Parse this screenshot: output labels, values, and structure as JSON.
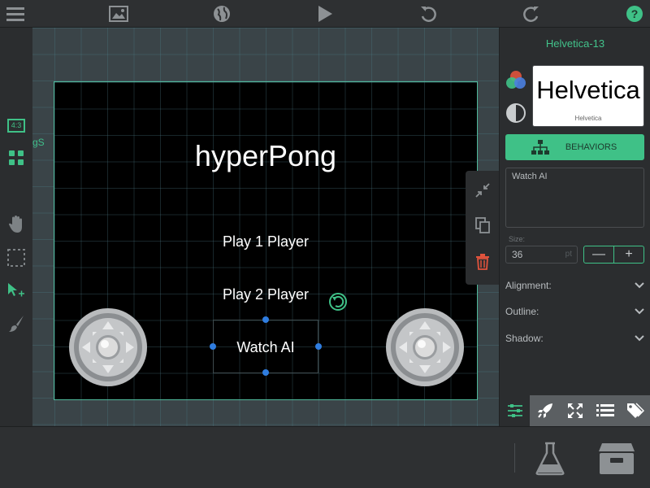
{
  "toolbar": {
    "icons": [
      "menu-icon",
      "image-icon",
      "globe-icon",
      "play-icon",
      "undo-icon",
      "redo-icon",
      "help-icon"
    ]
  },
  "leftbar": {
    "aspect_label": "4:3"
  },
  "canvas": {
    "side_label": "gS",
    "title": "hyperPong",
    "menu": {
      "play1": "Play 1 Player",
      "play2": "Play 2 Player",
      "watch_ai": "Watch AI"
    }
  },
  "panel": {
    "font_name": "Helvetica-13",
    "preview_big": "Helvetica",
    "preview_small": "Helvetica",
    "behaviors_label": "BEHAVIORS",
    "text_value": "Watch AI",
    "size_label": "Size:",
    "size_value": "36",
    "size_unit": "pt",
    "alignment_label": "Alignment:",
    "outline_label": "Outline:",
    "shadow_label": "Shadow:"
  },
  "colors": {
    "accent": "#3fc187",
    "selection_handle": "#2f7de0"
  }
}
